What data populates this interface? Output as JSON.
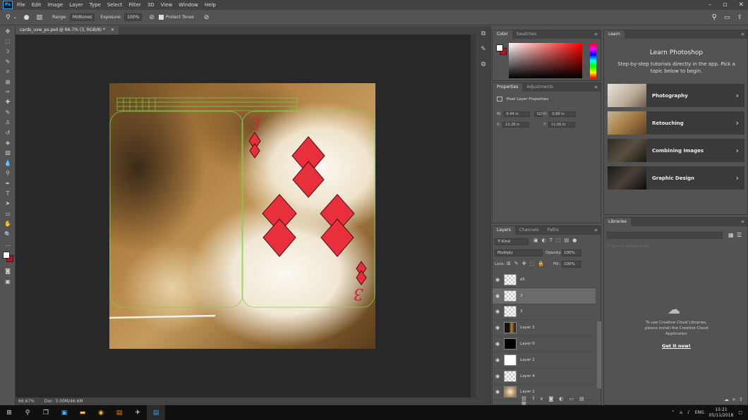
{
  "menu": [
    "File",
    "Edit",
    "Image",
    "Layer",
    "Type",
    "Select",
    "Filter",
    "3D",
    "View",
    "Window",
    "Help"
  ],
  "app_badge": "Ps",
  "options": {
    "range_label": "Range:",
    "range_value": "Midtones",
    "exposure_label": "Exposure:",
    "exposure_value": "100%",
    "protect_tones": "Protect Tones"
  },
  "document": {
    "tab_title": "cards_uvw_ps.psd @ 66.7% (3, RGB/8) *",
    "close": "×",
    "zoom": "66.67%",
    "doc_info": "Doc: 3.00M/46.6M"
  },
  "canvas": {
    "rank_top": "3",
    "rank_bottom": "3"
  },
  "color_panel": {
    "tabs": [
      "Color",
      "Swatches"
    ],
    "fg_color": "#ffffff",
    "bg_color": "#c0101a"
  },
  "properties_panel": {
    "tabs": [
      "Properties",
      "Adjustments"
    ],
    "section": "Pixel Layer Properties",
    "w_label": "W:",
    "w": "0.44 in",
    "h_label": "H:",
    "h": "0.68 in",
    "x_label": "X:",
    "x": "13.28 in",
    "y_label": "Y:",
    "y": "11.06 in",
    "link": "GO"
  },
  "layers_panel": {
    "tabs": [
      "Layers",
      "Channels",
      "Paths"
    ],
    "kind": "Kind",
    "blend": "Multiply",
    "opacity_label": "Opacity:",
    "opacity": "100%",
    "lock_label": "Lock:",
    "fill_label": "Fill:",
    "fill": "100%",
    "layers": [
      {
        "name": "d5",
        "type": "transparent",
        "selected": false
      },
      {
        "name": "3",
        "type": "transparent",
        "selected": true
      },
      {
        "name": "3",
        "type": "transparent",
        "selected": false
      },
      {
        "name": "Layer 3",
        "type": "dark",
        "selected": false
      },
      {
        "name": "Layer 0",
        "type": "black",
        "selected": false
      },
      {
        "name": "Layer 2",
        "type": "white",
        "selected": false
      },
      {
        "name": "Layer 4",
        "type": "transparent",
        "selected": false
      },
      {
        "name": "Layer 1",
        "type": "photo",
        "selected": false
      }
    ]
  },
  "learn_panel": {
    "tab": "Learn",
    "title": "Learn Photoshop",
    "subtitle": "Step-by-step tutorials directly in the app. Pick a topic below to begin.",
    "topics": [
      "Photography",
      "Retouching",
      "Combining Images",
      "Graphic Design"
    ]
  },
  "libraries_panel": {
    "tab": "Libraries",
    "search_placeholder": "Search Adobe Stock",
    "message": "To use Creative Cloud Libraries, please install the Creative Cloud Application",
    "cta": "Get it now!"
  },
  "taskbar": {
    "lang": "ENG",
    "time": "15:21",
    "date": "05/11/2018"
  }
}
